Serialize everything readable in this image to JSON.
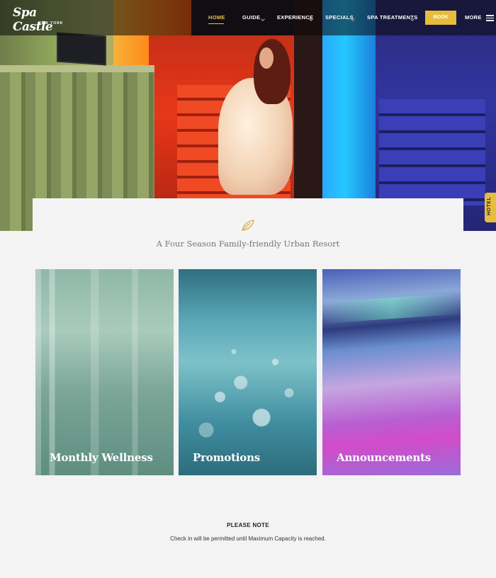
{
  "brand": {
    "logo_text": "Spa Castle",
    "logo_sub": "NEW YORK"
  },
  "nav": {
    "items": [
      {
        "label": "HOME",
        "active": true
      },
      {
        "label": "GUIDE"
      },
      {
        "label": "EXPERIENCE"
      },
      {
        "label": "SPECIALS"
      },
      {
        "label": "SPA TREATMENTS"
      }
    ],
    "book_label": "BOOK",
    "more_label": "MORE"
  },
  "side_tab": {
    "label": "HOTEL"
  },
  "tagline": "A Four Season Family-friendly Urban Resort",
  "cards": [
    {
      "label": "Monthly Wellness"
    },
    {
      "label": "Promotions"
    },
    {
      "label": "Announcements"
    }
  ],
  "notice": {
    "title": "PLEASE NOTE",
    "text": "Check in will be permitted until Maximum Capacity is reached."
  },
  "colors": {
    "accent": "#e6bd3d",
    "nav_active": "#e7c44b",
    "page_bg": "#f3f3f3"
  },
  "icons": {
    "tagline_icon": "leaf-icon",
    "menu": "hamburger-menu-icon"
  }
}
